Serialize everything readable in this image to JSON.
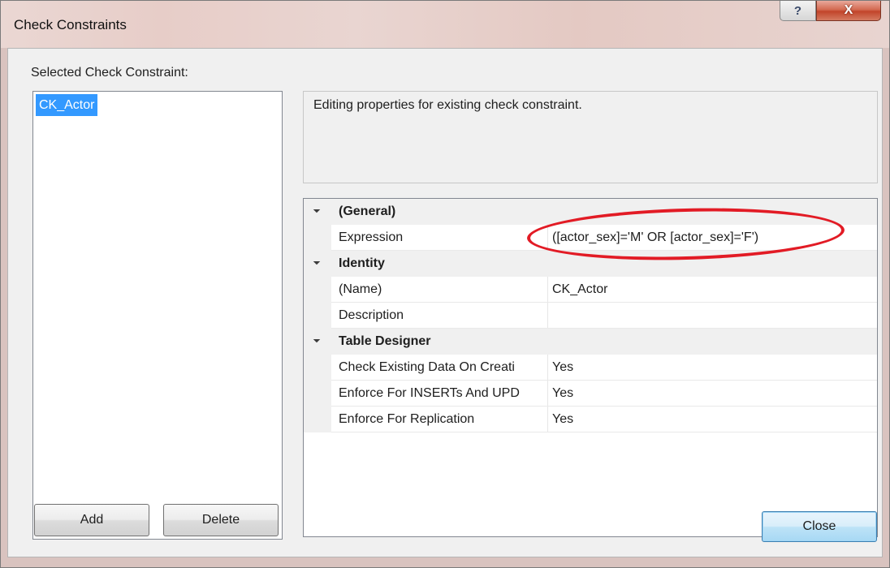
{
  "window": {
    "title": "Check Constraints",
    "help_glyph": "?",
    "close_glyph": "X"
  },
  "left": {
    "label": "Selected Check Constraint:",
    "items": [
      {
        "name": "CK_Actor",
        "selected": true
      }
    ],
    "add_label": "Add",
    "delete_label": "Delete"
  },
  "description": {
    "text": "Editing properties for existing check constraint."
  },
  "properties": {
    "general": {
      "label": "(General)",
      "expression_name": "Expression",
      "expression_value": "([actor_sex]='M' OR [actor_sex]='F')"
    },
    "identity": {
      "label": "Identity",
      "name_label": "(Name)",
      "name_value": "CK_Actor",
      "description_label": "Description",
      "description_value": ""
    },
    "table_designer": {
      "label": "Table Designer",
      "check_existing_label": "Check Existing Data On Creati",
      "check_existing_value": "Yes",
      "enforce_insert_label": "Enforce For INSERTs And UPD",
      "enforce_insert_value": "Yes",
      "enforce_replication_label": "Enforce For Replication",
      "enforce_replication_value": "Yes"
    }
  },
  "footer": {
    "close_label": "Close"
  },
  "colors": {
    "selection": "#3399ff",
    "annotation": "#e21b25",
    "close_accent": "#3c7fb1"
  }
}
